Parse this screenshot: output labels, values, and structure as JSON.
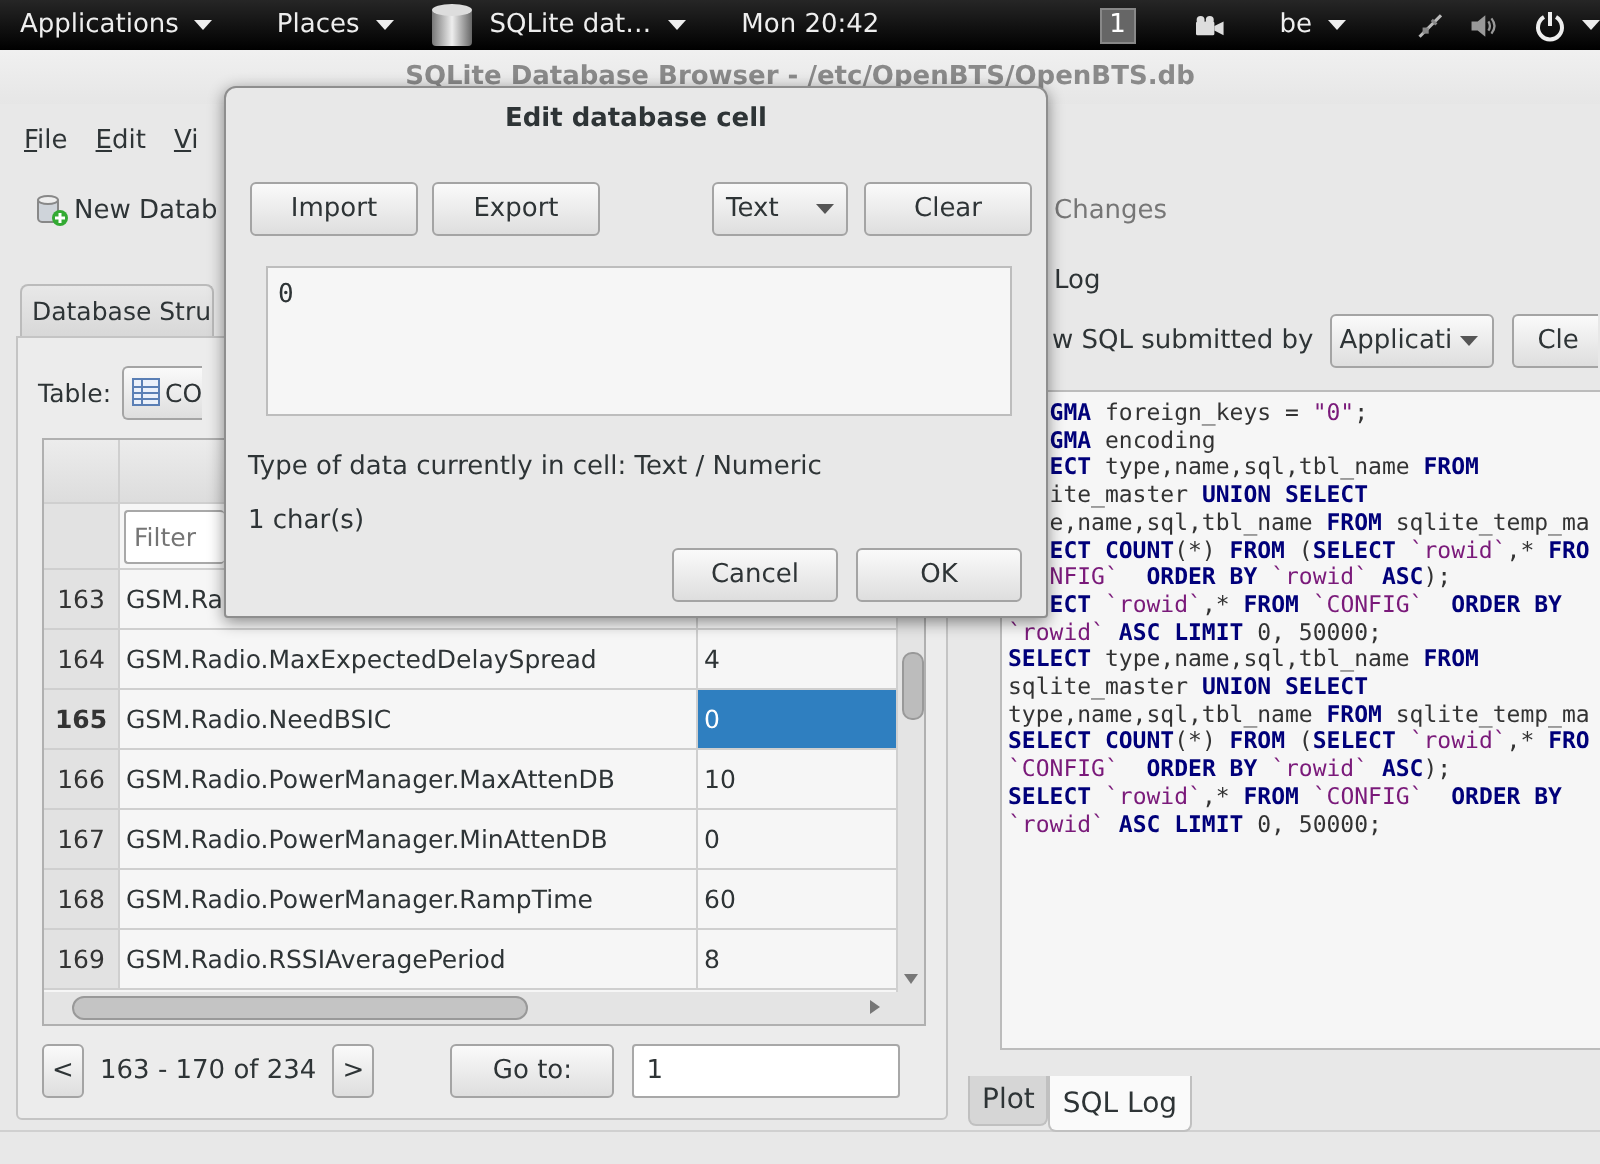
{
  "top_bar": {
    "applications": "Applications",
    "places": "Places",
    "active_app": "SQLite dat…",
    "clock": "Mon 20:42",
    "workspace": "1",
    "keyboard_layout": "be"
  },
  "window": {
    "title": "SQLite Database Browser - /etc/OpenBTS/OpenBTS.db",
    "menu": [
      "File",
      "Edit",
      "Vi"
    ],
    "toolbar": [
      {
        "label": "New Datab",
        "disabled": false
      },
      {
        "label": "Changes",
        "disabled": true
      }
    ]
  },
  "browse_panel": {
    "tab": "Database Stru",
    "table_label": "Table:",
    "table_combo": "CO",
    "filter_placeholder": "Filter",
    "rows": [
      {
        "number": "163",
        "name": "GSM.Ra",
        "selected": false
      },
      {
        "number": "164",
        "name": "GSM.Radio.MaxExpectedDelaySpread",
        "value": "4",
        "selected": false
      },
      {
        "number": "165",
        "name": "GSM.Radio.NeedBSIC",
        "value": "0",
        "selected": true
      },
      {
        "number": "166",
        "name": "GSM.Radio.PowerManager.MaxAttenDB",
        "value": "10",
        "selected": false
      },
      {
        "number": "167",
        "name": "GSM.Radio.PowerManager.MinAttenDB",
        "value": "0",
        "selected": false
      },
      {
        "number": "168",
        "name": "GSM.Radio.PowerManager.RampTime",
        "value": "60",
        "selected": false
      },
      {
        "number": "169",
        "name": "GSM.Radio.RSSIAveragePeriod",
        "value": "8",
        "selected": false
      }
    ],
    "pager": {
      "prev": "<",
      "range": "163 - 170 of 234",
      "next": ">",
      "goto_button": "Go to:",
      "goto_value": "1"
    }
  },
  "sql_log_dock": {
    "title": "Log",
    "submitted_by_label": "w SQL submitted by",
    "submitted_by": "Applicati",
    "clear_button": "Cle",
    "lines": [
      [
        {
          "kind": "kw",
          "text": "GMA"
        },
        {
          "kind": "txt",
          "text": " foreign_keys = "
        },
        {
          "kind": "str",
          "text": "\"0\""
        },
        {
          "kind": "txt",
          "text": ";"
        }
      ],
      [
        {
          "kind": "kw",
          "text": "GMA"
        },
        {
          "kind": "txt",
          "text": " encoding"
        }
      ],
      [
        {
          "kind": "kw",
          "text": "ECT"
        },
        {
          "kind": "txt",
          "text": " type,name,sql,tbl_name "
        },
        {
          "kind": "kw",
          "text": "FROM"
        }
      ],
      [
        {
          "kind": "txt",
          "text": "ite_master "
        },
        {
          "kind": "kw",
          "text": "UNION SELECT"
        }
      ],
      [
        {
          "kind": "txt",
          "text": "e,name,sql,tbl_name "
        },
        {
          "kind": "kw",
          "text": "FROM"
        },
        {
          "kind": "txt",
          "text": " sqlite_temp_ma"
        }
      ],
      [
        {
          "kind": "kw",
          "text": "ECT COUNT"
        },
        {
          "kind": "txt",
          "text": "(*) "
        },
        {
          "kind": "kw",
          "text": "FROM"
        },
        {
          "kind": "txt",
          "text": " ("
        },
        {
          "kind": "kw",
          "text": "SELECT"
        },
        {
          "kind": "str",
          "text": " `rowid`"
        },
        {
          "kind": "txt",
          "text": ",* "
        },
        {
          "kind": "kw",
          "text": "FRO"
        }
      ],
      [
        {
          "kind": "str",
          "text": "NFIG`  "
        },
        {
          "kind": "kw",
          "text": "ORDER BY"
        },
        {
          "kind": "str",
          "text": " `rowid` "
        },
        {
          "kind": "kw",
          "text": "ASC"
        },
        {
          "kind": "txt",
          "text": ");"
        }
      ],
      [
        {
          "kind": "kw",
          "text": "ECT "
        },
        {
          "kind": "str",
          "text": "`rowid`"
        },
        {
          "kind": "txt",
          "text": ",* "
        },
        {
          "kind": "kw",
          "text": "FROM "
        },
        {
          "kind": "str",
          "text": "`CONFIG`  "
        },
        {
          "kind": "kw",
          "text": "ORDER BY"
        }
      ],
      [
        {
          "kind": "str",
          "text": "`rowid` "
        },
        {
          "kind": "kw",
          "text": "ASC LIMIT"
        },
        {
          "kind": "txt",
          "text": " 0, 50000;"
        }
      ],
      [
        {
          "kind": "kw",
          "text": "SELECT"
        },
        {
          "kind": "txt",
          "text": " type,name,sql,tbl_name "
        },
        {
          "kind": "kw",
          "text": "FROM"
        }
      ],
      [
        {
          "kind": "txt",
          "text": "sqlite_master "
        },
        {
          "kind": "kw",
          "text": "UNION SELECT"
        }
      ],
      [
        {
          "kind": "txt",
          "text": "type,name,sql,tbl_name "
        },
        {
          "kind": "kw",
          "text": "FROM"
        },
        {
          "kind": "txt",
          "text": " sqlite_temp_ma"
        }
      ],
      [
        {
          "kind": "kw",
          "text": "SELECT COUNT"
        },
        {
          "kind": "txt",
          "text": "(*) "
        },
        {
          "kind": "kw",
          "text": "FROM"
        },
        {
          "kind": "txt",
          "text": " ("
        },
        {
          "kind": "kw",
          "text": "SELECT"
        },
        {
          "kind": "str",
          "text": " `rowid`"
        },
        {
          "kind": "txt",
          "text": ",* "
        },
        {
          "kind": "kw",
          "text": "FRO"
        }
      ],
      [
        {
          "kind": "str",
          "text": "`CONFIG`  "
        },
        {
          "kind": "kw",
          "text": "ORDER BY"
        },
        {
          "kind": "str",
          "text": " `rowid` "
        },
        {
          "kind": "kw",
          "text": "ASC"
        },
        {
          "kind": "txt",
          "text": ");"
        }
      ],
      [
        {
          "kind": "kw",
          "text": "SELECT "
        },
        {
          "kind": "str",
          "text": "`rowid`"
        },
        {
          "kind": "txt",
          "text": ",* "
        },
        {
          "kind": "kw",
          "text": "FROM "
        },
        {
          "kind": "str",
          "text": "`CONFIG`  "
        },
        {
          "kind": "kw",
          "text": "ORDER BY"
        }
      ],
      [
        {
          "kind": "str",
          "text": "`rowid` "
        },
        {
          "kind": "kw",
          "text": "ASC LIMIT"
        },
        {
          "kind": "txt",
          "text": " 0, 50000;"
        }
      ]
    ],
    "tabs": [
      {
        "label": "Plot",
        "selected": false
      },
      {
        "label": "SQL Log",
        "selected": true
      }
    ]
  },
  "dialog": {
    "title": "Edit database cell",
    "import_button": "Import",
    "export_button": "Export",
    "mode": "Text",
    "clear_button": "Clear",
    "value": "0",
    "type_info": "Type of data currently in cell: Text / Numeric",
    "size_info": "1 char(s)",
    "cancel_button": "Cancel",
    "ok_button": "OK"
  }
}
